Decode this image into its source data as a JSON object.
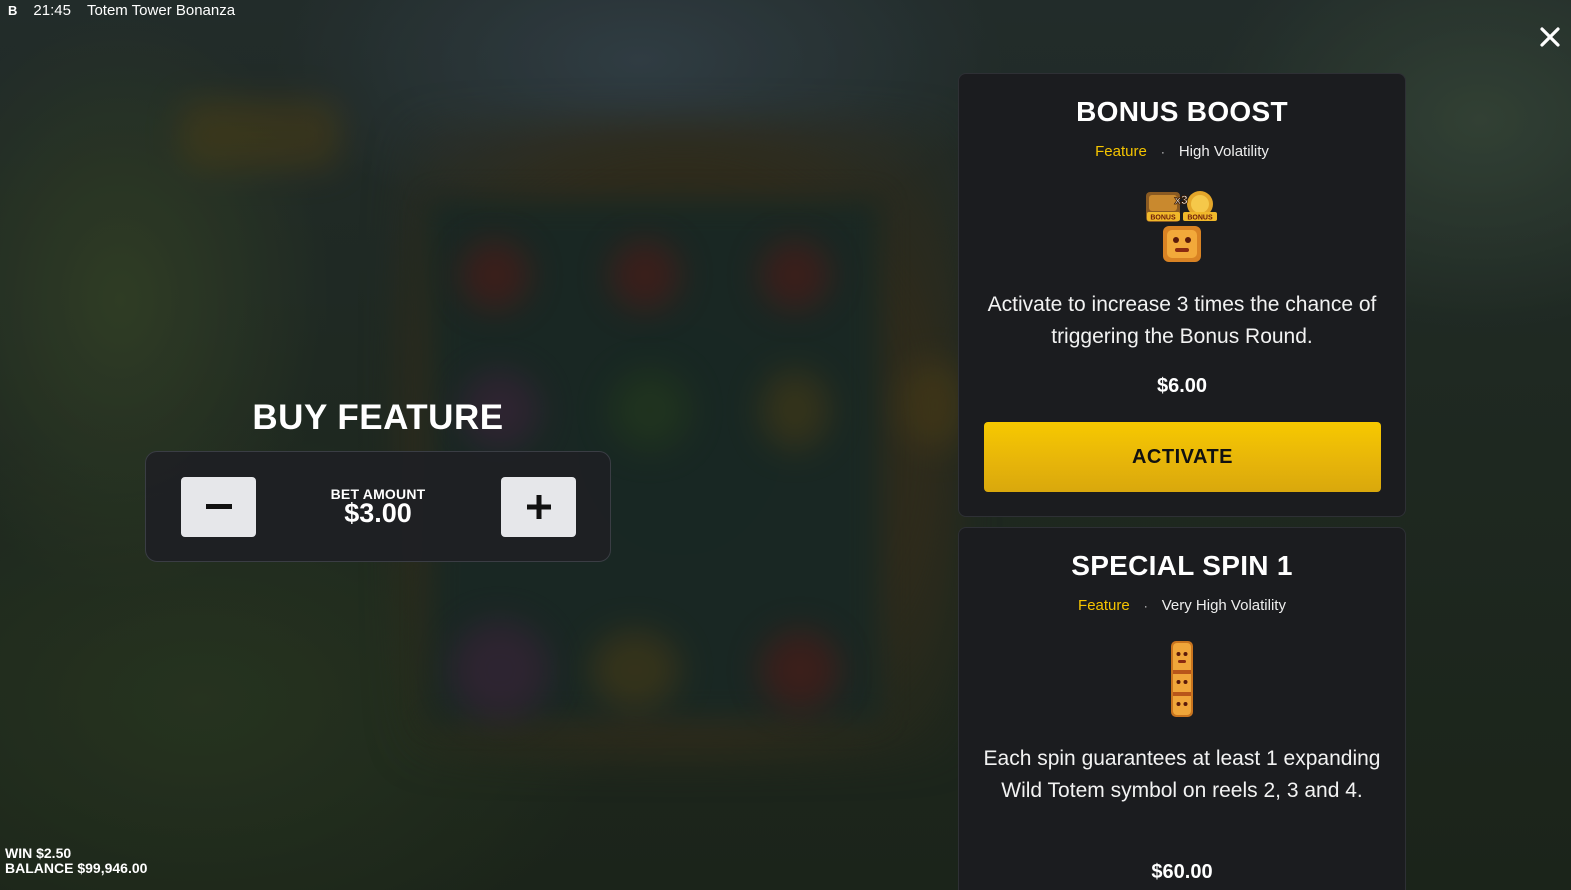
{
  "topbar": {
    "brand": "B",
    "time": "21:45",
    "game_title": "Totem Tower Bonanza"
  },
  "buy_feature": {
    "title": "BUY FEATURE",
    "bet_label": "BET AMOUNT",
    "bet_value": "$3.00",
    "decrease_label": "−",
    "increase_label": "+"
  },
  "features": [
    {
      "title": "BONUS BOOST",
      "type": "Feature",
      "separator": "·",
      "volatility": "High Volatility",
      "icon": "bonus-x3-totem-icon",
      "description": "Activate to increase 3 times the chance of triggering the Bonus Round.",
      "price": "$6.00",
      "button_label": "ACTIVATE"
    },
    {
      "title": "SPECIAL SPIN 1",
      "type": "Feature",
      "separator": "·",
      "volatility": "Very High Volatility",
      "icon": "wild-totem-icon",
      "description": "Each spin guarantees at least 1 expanding Wild Totem symbol on reels 2, 3 and 4.",
      "price": "$60.00"
    }
  ],
  "footer": {
    "win": "WIN $2.50",
    "balance": "BALANCE $99,946.00"
  },
  "colors": {
    "accent_yellow": "#f5c400",
    "card_bg": "#1b1c1f",
    "button_light": "#e6e7ea"
  }
}
